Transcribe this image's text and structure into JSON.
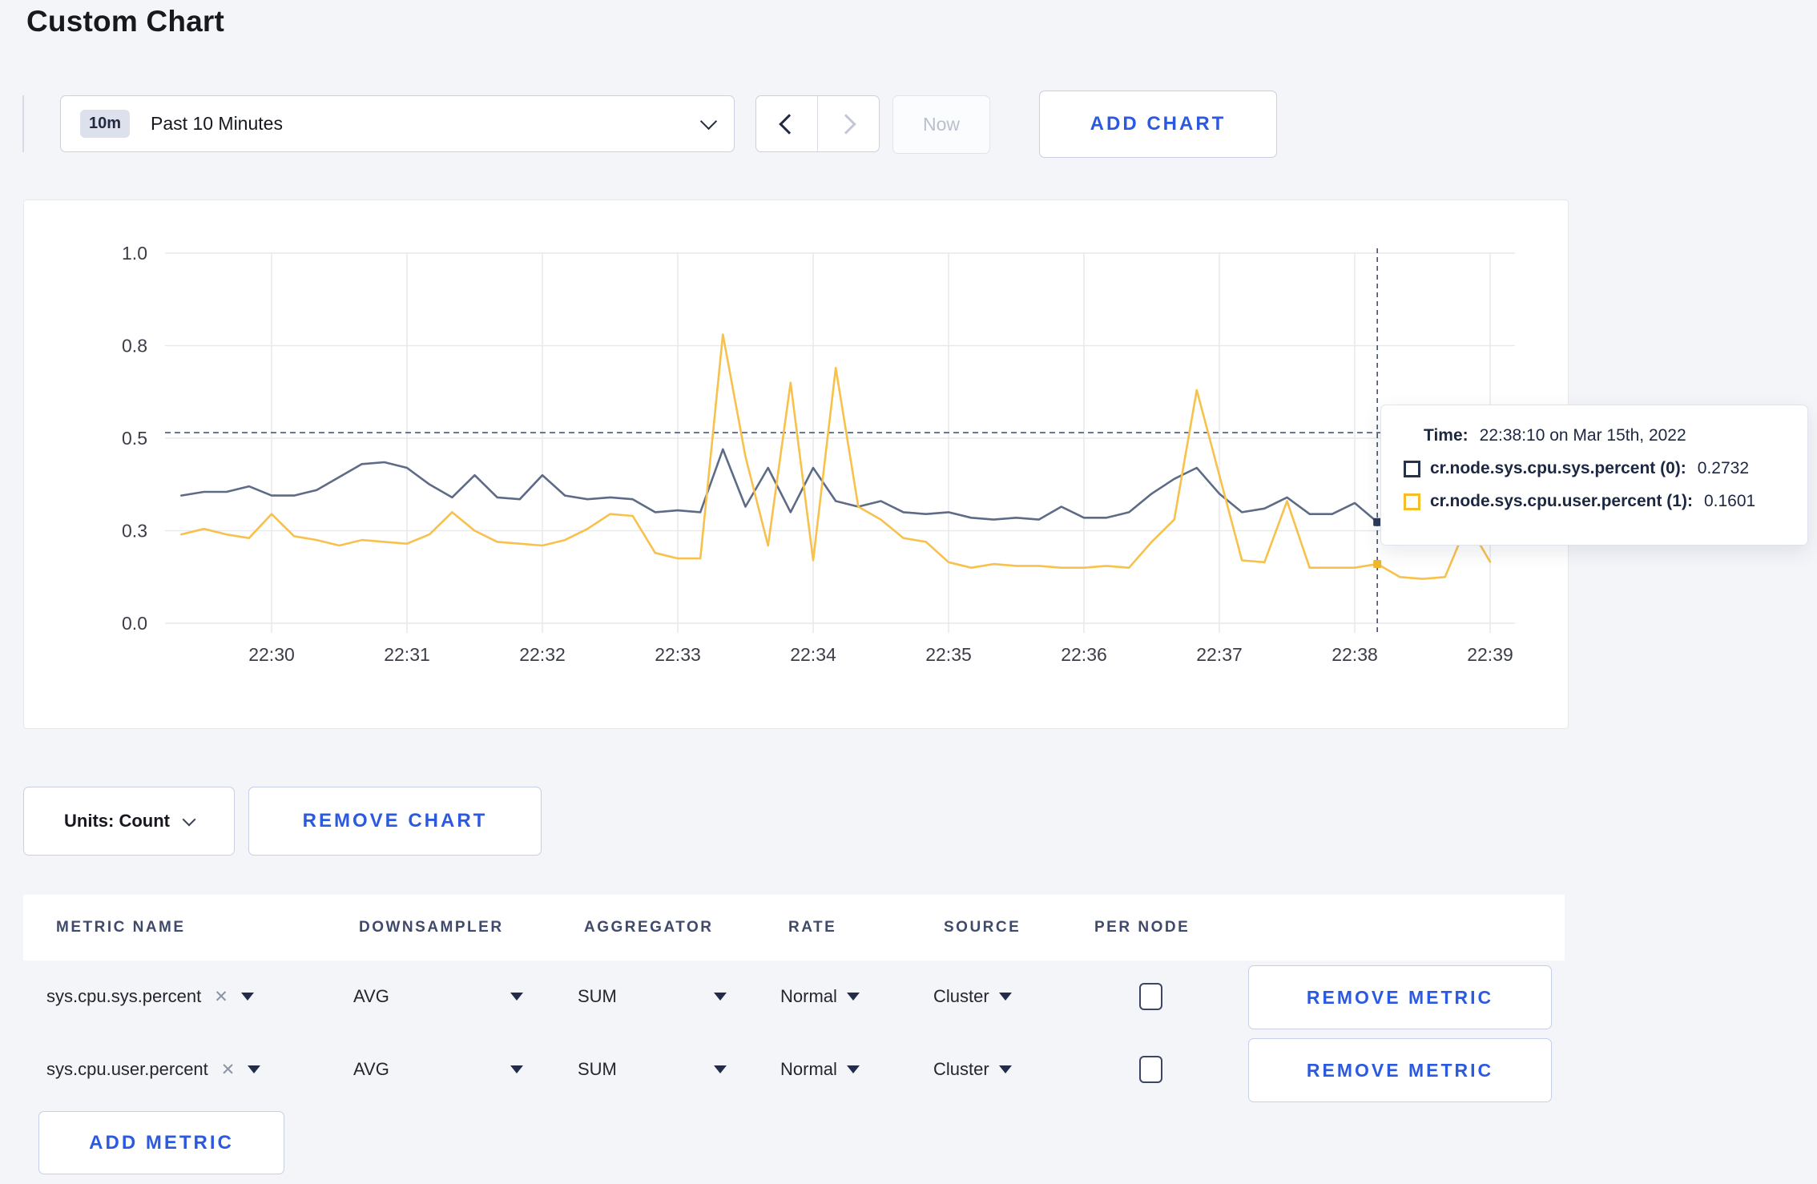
{
  "page": {
    "title": "Custom Chart"
  },
  "toolbar": {
    "time_badge": "10m",
    "time_label": "Past 10 Minutes",
    "now_label": "Now",
    "add_chart_label": "ADD CHART"
  },
  "chart_data": {
    "type": "line",
    "title": "",
    "xlabel": "",
    "ylabel": "",
    "ylim": [
      0,
      1
    ],
    "grid": true,
    "x_ticks": [
      "22:30",
      "22:31",
      "22:32",
      "22:33",
      "22:34",
      "22:35",
      "22:36",
      "22:37",
      "22:38",
      "22:39"
    ],
    "y_ticks": [
      {
        "label": "1.0",
        "value": 1.0
      },
      {
        "label": "0.8",
        "value": 0.75
      },
      {
        "label": "0.5",
        "value": 0.5
      },
      {
        "label": "0.3",
        "value": 0.25
      },
      {
        "label": "0.0",
        "value": 0.0
      }
    ],
    "x_unit": "seconds relative to 22:30:00",
    "series": [
      {
        "name": "cr.node.sys.cpu.sys.percent",
        "color": "#5e6b87",
        "dot_color": "#2c3a58",
        "points": [
          [
            -40,
            0.345
          ],
          [
            -30,
            0.355
          ],
          [
            -20,
            0.355
          ],
          [
            -10,
            0.37
          ],
          [
            0,
            0.345
          ],
          [
            10,
            0.345
          ],
          [
            20,
            0.36
          ],
          [
            30,
            0.395
          ],
          [
            40,
            0.43
          ],
          [
            50,
            0.435
          ],
          [
            60,
            0.42
          ],
          [
            70,
            0.375
          ],
          [
            80,
            0.34
          ],
          [
            90,
            0.4
          ],
          [
            100,
            0.34
          ],
          [
            110,
            0.335
          ],
          [
            120,
            0.4
          ],
          [
            130,
            0.345
          ],
          [
            140,
            0.335
          ],
          [
            150,
            0.34
          ],
          [
            160,
            0.335
          ],
          [
            170,
            0.3
          ],
          [
            180,
            0.305
          ],
          [
            190,
            0.3
          ],
          [
            200,
            0.47
          ],
          [
            210,
            0.315
          ],
          [
            220,
            0.42
          ],
          [
            230,
            0.3
          ],
          [
            240,
            0.42
          ],
          [
            250,
            0.33
          ],
          [
            260,
            0.315
          ],
          [
            270,
            0.33
          ],
          [
            280,
            0.3
          ],
          [
            290,
            0.295
          ],
          [
            300,
            0.3
          ],
          [
            310,
            0.285
          ],
          [
            320,
            0.28
          ],
          [
            330,
            0.285
          ],
          [
            340,
            0.28
          ],
          [
            350,
            0.315
          ],
          [
            360,
            0.285
          ],
          [
            370,
            0.285
          ],
          [
            380,
            0.3
          ],
          [
            390,
            0.35
          ],
          [
            400,
            0.39
          ],
          [
            410,
            0.42
          ],
          [
            420,
            0.35
          ],
          [
            430,
            0.3
          ],
          [
            440,
            0.31
          ],
          [
            450,
            0.34
          ],
          [
            460,
            0.295
          ],
          [
            470,
            0.295
          ],
          [
            480,
            0.325
          ],
          [
            490,
            0.2732
          ],
          [
            500,
            0.255
          ],
          [
            510,
            0.28
          ],
          [
            520,
            0.3
          ],
          [
            530,
            0.32
          ],
          [
            540,
            0.31
          ]
        ]
      },
      {
        "name": "cr.node.sys.cpu.user.percent",
        "color": "#f7c14b",
        "dot_color": "#f0b62a",
        "points": [
          [
            -40,
            0.24
          ],
          [
            -30,
            0.255
          ],
          [
            -20,
            0.24
          ],
          [
            -10,
            0.23
          ],
          [
            0,
            0.295
          ],
          [
            10,
            0.235
          ],
          [
            20,
            0.225
          ],
          [
            30,
            0.21
          ],
          [
            40,
            0.225
          ],
          [
            50,
            0.22
          ],
          [
            60,
            0.215
          ],
          [
            70,
            0.24
          ],
          [
            80,
            0.3
          ],
          [
            90,
            0.25
          ],
          [
            100,
            0.22
          ],
          [
            110,
            0.215
          ],
          [
            120,
            0.21
          ],
          [
            130,
            0.225
          ],
          [
            140,
            0.255
          ],
          [
            150,
            0.295
          ],
          [
            160,
            0.29
          ],
          [
            170,
            0.19
          ],
          [
            180,
            0.175
          ],
          [
            190,
            0.175
          ],
          [
            200,
            0.78
          ],
          [
            210,
            0.45
          ],
          [
            220,
            0.21
          ],
          [
            230,
            0.65
          ],
          [
            240,
            0.17
          ],
          [
            250,
            0.69
          ],
          [
            260,
            0.315
          ],
          [
            270,
            0.28
          ],
          [
            280,
            0.23
          ],
          [
            290,
            0.22
          ],
          [
            300,
            0.165
          ],
          [
            310,
            0.15
          ],
          [
            320,
            0.16
          ],
          [
            330,
            0.155
          ],
          [
            340,
            0.155
          ],
          [
            350,
            0.15
          ],
          [
            360,
            0.15
          ],
          [
            370,
            0.155
          ],
          [
            380,
            0.15
          ],
          [
            390,
            0.22
          ],
          [
            400,
            0.28
          ],
          [
            410,
            0.63
          ],
          [
            420,
            0.4
          ],
          [
            430,
            0.17
          ],
          [
            440,
            0.165
          ],
          [
            450,
            0.33
          ],
          [
            460,
            0.15
          ],
          [
            470,
            0.15
          ],
          [
            480,
            0.15
          ],
          [
            490,
            0.1601
          ],
          [
            500,
            0.125
          ],
          [
            510,
            0.12
          ],
          [
            520,
            0.125
          ],
          [
            530,
            0.27
          ],
          [
            540,
            0.166
          ]
        ]
      }
    ],
    "hover": {
      "seconds": 490,
      "guide_value": 0.515
    }
  },
  "tooltip": {
    "time_label": "Time:",
    "time_value": "22:38:10 on Mar 15th, 2022",
    "rows": [
      {
        "name": "cr.node.sys.cpu.sys.percent (0):",
        "value": "0.2732",
        "swatch": "#26324c"
      },
      {
        "name": "cr.node.sys.cpu.user.percent (1):",
        "value": "0.1601",
        "swatch": "#f5bd27"
      }
    ]
  },
  "chart_controls": {
    "units_label": "Units: Count",
    "remove_chart_label": "REMOVE CHART"
  },
  "table": {
    "headers": [
      "METRIC NAME",
      "DOWNSAMPLER",
      "AGGREGATOR",
      "RATE",
      "SOURCE",
      "PER NODE"
    ],
    "rows": [
      {
        "metric": "sys.cpu.sys.percent",
        "downsampler": "AVG",
        "aggregator": "SUM",
        "rate": "Normal",
        "source": "Cluster",
        "per_node_checked": false,
        "remove_label": "REMOVE METRIC"
      },
      {
        "metric": "sys.cpu.user.percent",
        "downsampler": "AVG",
        "aggregator": "SUM",
        "rate": "Normal",
        "source": "Cluster",
        "per_node_checked": false,
        "remove_label": "REMOVE METRIC"
      }
    ],
    "add_metric_label": "ADD METRIC"
  }
}
